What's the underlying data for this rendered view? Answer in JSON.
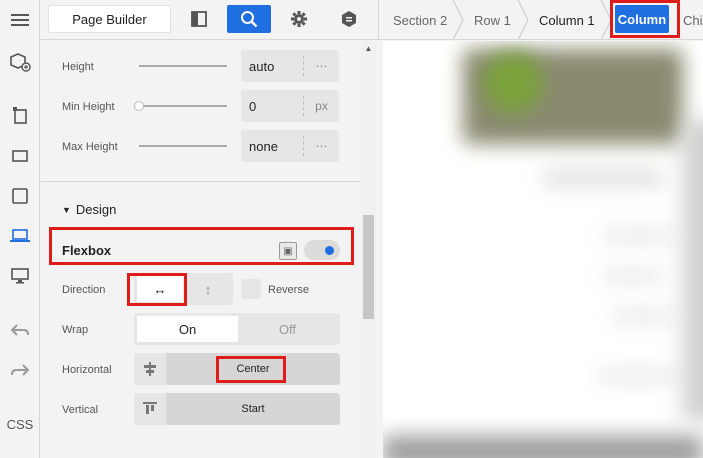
{
  "toolbar": {
    "title": "Page Builder",
    "icons": [
      "panel-toggle-icon",
      "search-icon",
      "gear-icon",
      "hex-badge-icon"
    ]
  },
  "breadcrumbs": [
    "Section 2",
    "Row 1",
    "Column 1",
    "Column",
    "Chil"
  ],
  "rail": {
    "icons": [
      "menu-icon",
      "add-block-icon",
      "structure-icon",
      "desktop-icon",
      "tablet-icon",
      "laptop-icon",
      "monitor-icon",
      "undo-icon",
      "redo-icon"
    ],
    "css_label": "CSS"
  },
  "size": {
    "height": {
      "label": "Height",
      "value": "auto",
      "unit": "⋯"
    },
    "min_height": {
      "label": "Min Height",
      "value": "0",
      "unit": "px"
    },
    "max_height": {
      "label": "Max Height",
      "value": "none",
      "unit": "⋯"
    }
  },
  "design": {
    "title": "Design",
    "flexbox_label": "Flexbox",
    "flexbox_enabled": true,
    "direction": {
      "label": "Direction",
      "horizontal": "↔",
      "vertical": "↕",
      "reverse_label": "Reverse",
      "selected": "horizontal"
    },
    "wrap": {
      "label": "Wrap",
      "on": "On",
      "off": "Off",
      "selected": "On"
    },
    "horizontal": {
      "label": "Horizontal",
      "value": "Center"
    },
    "vertical": {
      "label": "Vertical",
      "value": "Start"
    }
  },
  "colors": {
    "accent": "#1f6fe0",
    "highlight": "#e01b1b"
  }
}
